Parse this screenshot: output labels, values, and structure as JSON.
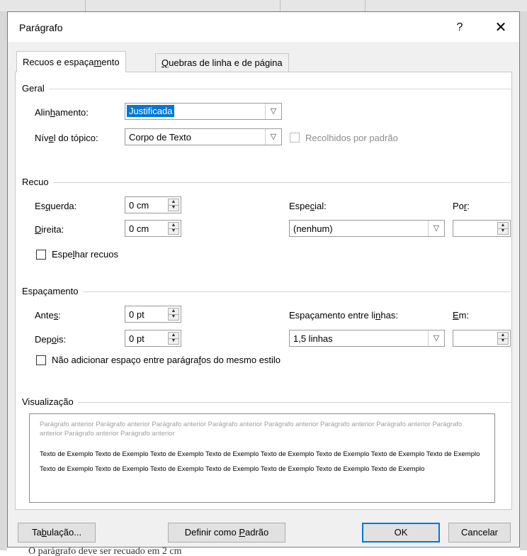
{
  "background": {
    "bottom_text": "O parágrafo deve ser recuado em 2 cm"
  },
  "dialog": {
    "title": "Parágrafo",
    "help": "?",
    "close": "✕"
  },
  "tabs": [
    {
      "label_pre": "Recuos e espaça",
      "label_u": "m",
      "label_post": "ento"
    },
    {
      "label_pre": "",
      "label_u": "Q",
      "label_post": "uebras de linha e de página"
    }
  ],
  "general": {
    "section": "Geral",
    "alignment_label_pre": "Alin",
    "alignment_label_u": "h",
    "alignment_label_post": "amento:",
    "alignment_value": "Justificada",
    "outline_label_pre": "Nív",
    "outline_label_u": "e",
    "outline_label_post": "l do tópico:",
    "outline_value": "Corpo de Texto",
    "collapsed_label": "Recolhidos por padrão"
  },
  "indent": {
    "section": "Recuo",
    "left_label_pre": "Es",
    "left_label_u": "q",
    "left_label_post": "uerda:",
    "left_value": "0 cm",
    "right_label_pre": "",
    "right_label_u": "D",
    "right_label_post": "ireita:",
    "right_value": "0 cm",
    "special_label_pre": "Espe",
    "special_label_u": "c",
    "special_label_post": "ial:",
    "special_value": "(nenhum)",
    "by_label_pre": "Po",
    "by_label_u": "r",
    "by_label_post": ":",
    "by_value": "",
    "mirror_label_pre": "Espe",
    "mirror_label_u": "l",
    "mirror_label_post": "har recuos"
  },
  "spacing": {
    "section": "Espaçamento",
    "before_label_pre": "Ante",
    "before_label_u": "s",
    "before_label_post": ":",
    "before_value": "0 pt",
    "after_label_pre": "Dep",
    "after_label_u": "o",
    "after_label_post": "is:",
    "after_value": "0 pt",
    "line_label_pre": "Espaçamento entre li",
    "line_label_u": "n",
    "line_label_post": "has:",
    "line_value": "1,5 linhas",
    "at_label_pre": "",
    "at_label_u": "E",
    "at_label_post": "m:",
    "at_value": "",
    "no_space_label_pre": "Não adicionar espaço entre parágra",
    "no_space_label_u": "f",
    "no_space_label_post": "os do mesmo estilo"
  },
  "preview": {
    "section": "Visualização",
    "previous_text": "Parágrafo anterior Parágrafo anterior Parágrafo anterior Parágrafo anterior Parágrafo anterior Parágrafo anterior Parágrafo anterior Parágrafo anterior Parágrafo anterior Parágrafo anterior",
    "sample_text": "Texto de Exemplo Texto de Exemplo Texto de Exemplo Texto de Exemplo Texto de Exemplo Texto de Exemplo Texto de Exemplo Texto de Exemplo Texto de Exemplo Texto de Exemplo Texto de Exemplo Texto de Exemplo Texto de Exemplo Texto de Exemplo Texto de Exemplo"
  },
  "buttons": {
    "tabs_pre": "Ta",
    "tabs_u": "b",
    "tabs_post": "ulação...",
    "default_pre": "Definir como ",
    "default_u": "P",
    "default_post": "adrão",
    "ok": "OK",
    "cancel": "Cancelar"
  }
}
